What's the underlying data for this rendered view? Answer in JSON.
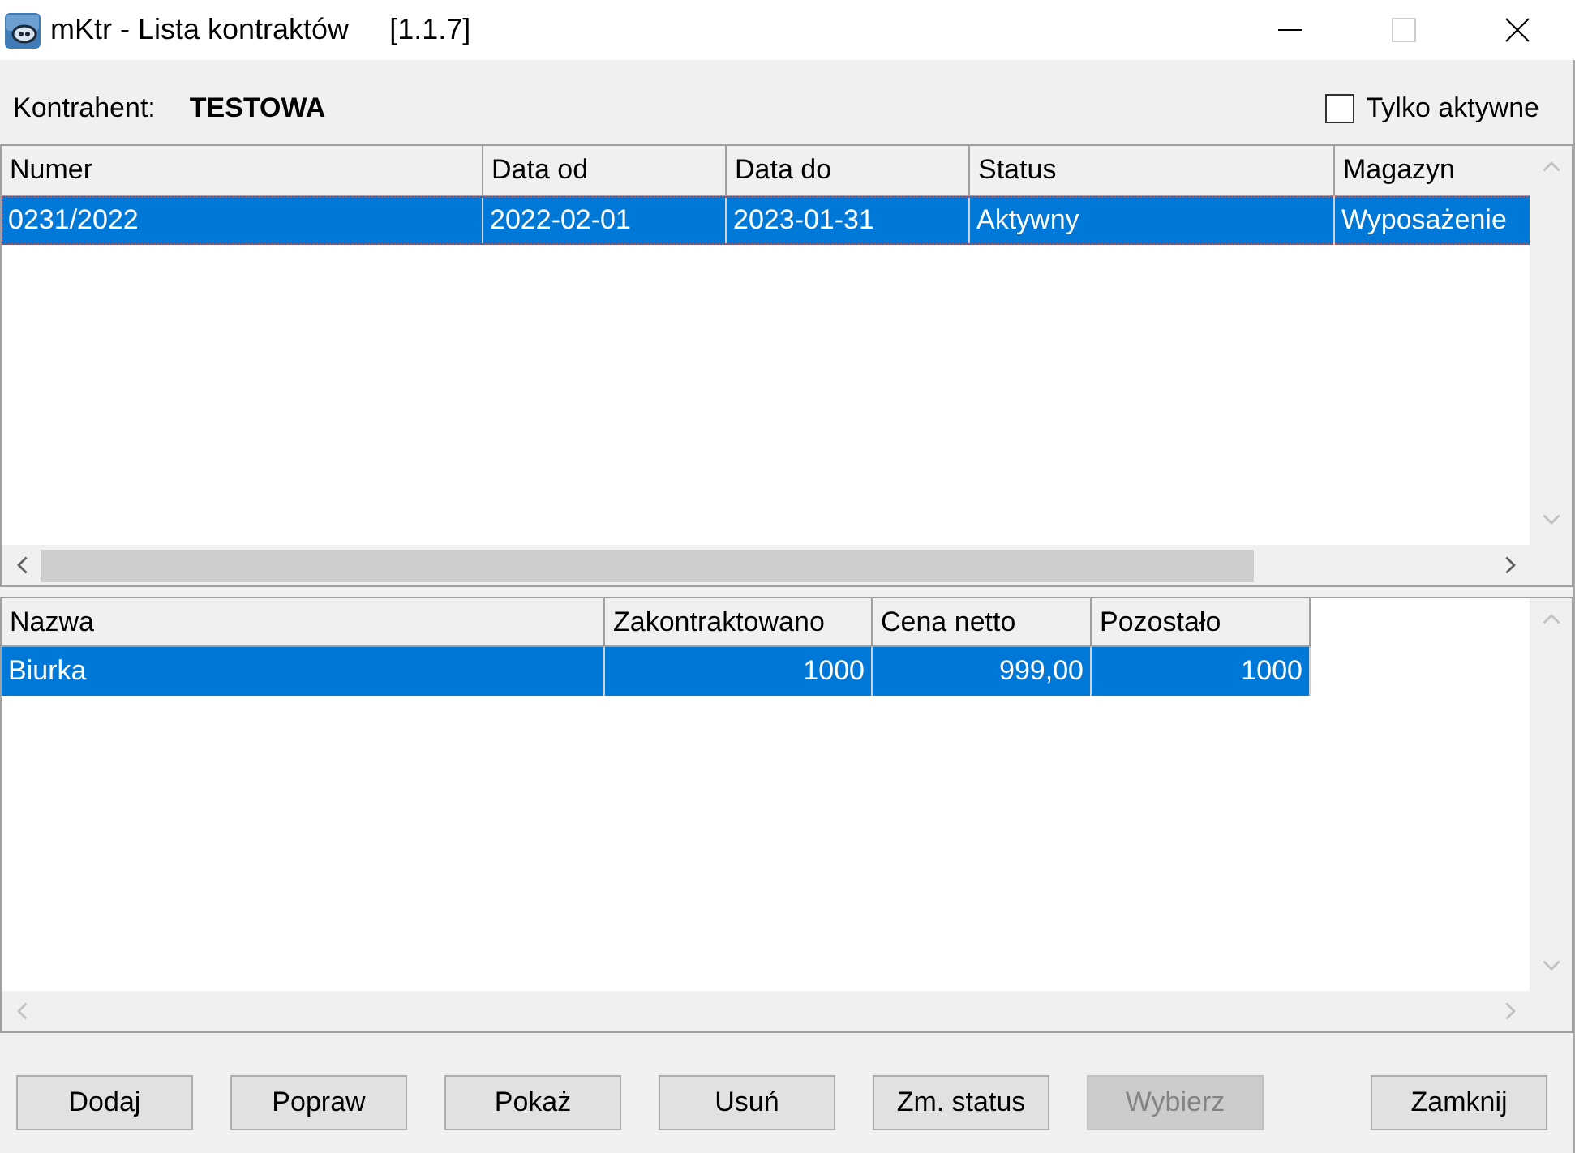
{
  "window": {
    "title": "mKtr - Lista kontraktów",
    "version": "[1.1.7]",
    "controls": [
      {
        "kind": "minimize",
        "disabled": false
      },
      {
        "kind": "maximize",
        "disabled": true
      },
      {
        "kind": "close",
        "disabled": false
      }
    ]
  },
  "contractor": {
    "label": "Kontrahent:",
    "value": "TESTOWA"
  },
  "filter": {
    "label": "Tylko aktywne",
    "checked": false
  },
  "contracts_table": {
    "columns": [
      {
        "label": "Numer",
        "kind": "text"
      },
      {
        "label": "Data od",
        "kind": "text"
      },
      {
        "label": "Data do",
        "kind": "text"
      },
      {
        "label": "Status",
        "kind": "text"
      },
      {
        "label": "Magazyn",
        "kind": "text"
      }
    ],
    "rows": [
      {
        "cells": [
          "0231/2022",
          "2022-02-01",
          "2023-01-31",
          "Aktywny",
          "Wyposażenie"
        ],
        "selected": true,
        "focused": true
      }
    ]
  },
  "items_table": {
    "columns": [
      {
        "label": "Nazwa",
        "kind": "text"
      },
      {
        "label": "Zakontraktowano",
        "kind": "number"
      },
      {
        "label": "Cena netto",
        "kind": "number"
      },
      {
        "label": "Pozostało",
        "kind": "number"
      }
    ],
    "rows": [
      {
        "cells": [
          "Biurka",
          "1000",
          "999,00",
          "1000"
        ],
        "selected": true,
        "focused": false
      }
    ]
  },
  "buttons": [
    {
      "label": "Dodaj",
      "disabled": false
    },
    {
      "label": "Popraw",
      "disabled": false
    },
    {
      "label": "Pokaż",
      "disabled": false
    },
    {
      "label": "Usuń",
      "disabled": false
    },
    {
      "label": "Zm. status",
      "disabled": false
    },
    {
      "label": "Wybierz",
      "disabled": true
    },
    {
      "label": "Zamknij",
      "disabled": false
    }
  ]
}
